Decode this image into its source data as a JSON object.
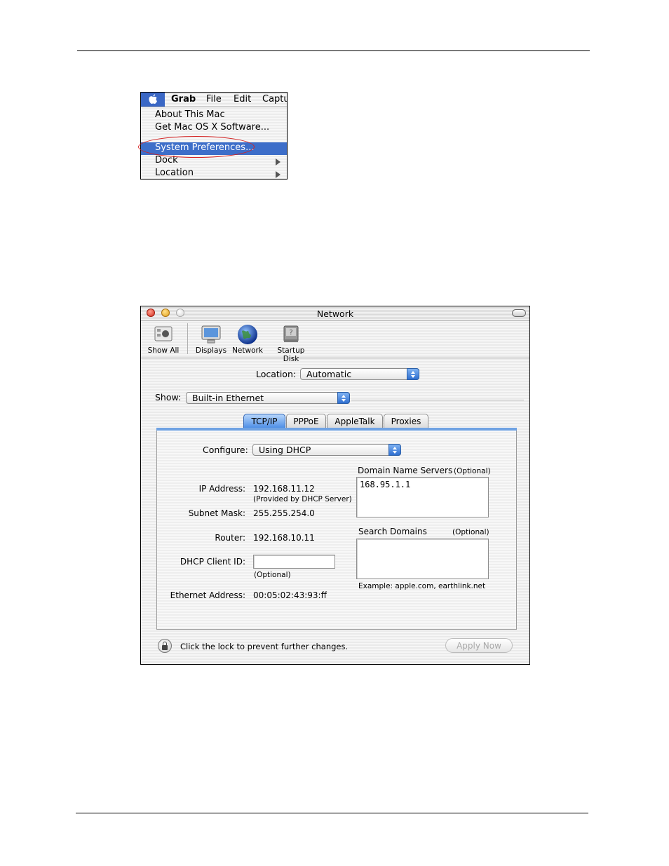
{
  "apple_menu": {
    "menubar": [
      "Grab",
      "File",
      "Edit",
      "Captu"
    ],
    "items": [
      "About This Mac",
      "Get Mac OS X Software...",
      "System Preferences...",
      "Dock",
      "Location"
    ]
  },
  "network_window": {
    "title": "Network",
    "toolbar": [
      "Show All",
      "Displays",
      "Network",
      "Startup Disk"
    ],
    "location_label": "Location:",
    "location_value": "Automatic",
    "show_label": "Show:",
    "show_value": "Built-in Ethernet",
    "tabs": [
      "TCP/IP",
      "PPPoE",
      "AppleTalk",
      "Proxies"
    ],
    "active_tab": "TCP/IP",
    "configure_label": "Configure:",
    "configure_value": "Using DHCP",
    "ip_label": "IP Address:",
    "ip_value": "192.168.11.12",
    "ip_note": "(Provided by DHCP Server)",
    "subnet_label": "Subnet Mask:",
    "subnet_value": "255.255.254.0",
    "router_label": "Router:",
    "router_value": "192.168.10.11",
    "dhcp_label": "DHCP Client ID:",
    "dhcp_value": "",
    "dhcp_note": "(Optional)",
    "ethernet_label": "Ethernet Address:",
    "ethernet_value": "00:05:02:43:93:ff",
    "dns_label": "Domain Name Servers",
    "dns_optional": "(Optional)",
    "dns_value": "168.95.1.1",
    "search_label": "Search Domains",
    "search_optional": "(Optional)",
    "search_value": "",
    "example": "Example: apple.com, earthlink.net",
    "lock_text": "Click the lock to prevent further changes.",
    "apply_label": "Apply Now"
  },
  "colors": {
    "selection_blue": "#3d6ec9",
    "tab_blue": "#4f8fe6",
    "highlight_red": "#d42020"
  }
}
